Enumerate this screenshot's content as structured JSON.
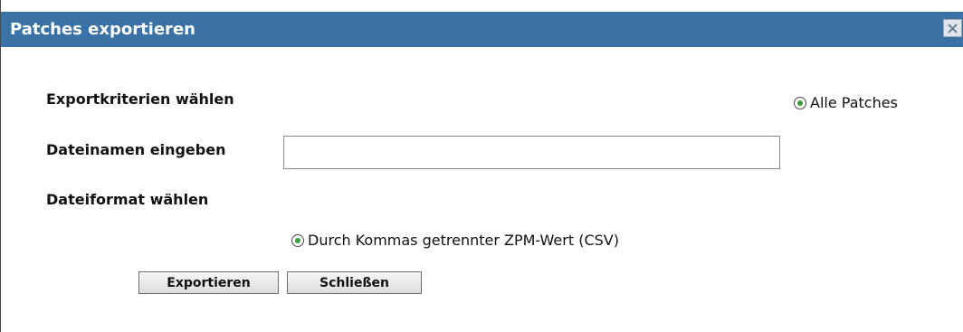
{
  "dialog": {
    "title": "Patches exportieren"
  },
  "form": {
    "criteria_label": "Exportkriterien wählen",
    "criteria_option": "Alle Patches",
    "filename_label": "Dateinamen eingeben",
    "filename_value": "",
    "filename_placeholder": "",
    "format_label": "Dateiformat wählen",
    "format_option": "Durch Kommas getrennter ZPM-Wert (CSV)"
  },
  "buttons": {
    "export_label": "Exportieren",
    "close_label": "Schließen"
  },
  "icons": {
    "close": "close-icon",
    "radio_selected": "radio-selected-icon"
  },
  "colors": {
    "titlebar": "#3b72a6",
    "radio_dot": "#3aa03a"
  }
}
